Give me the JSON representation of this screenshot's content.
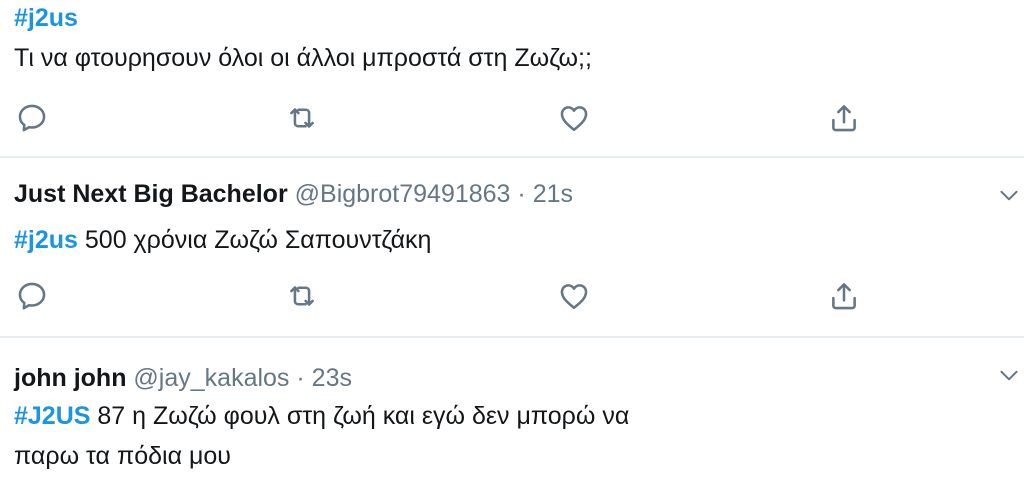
{
  "tweets": [
    {
      "hashtag": "#j2us",
      "text": "Τι να φτουρησουν όλοι οι άλλοι μπροστά στη Ζωζω;;"
    },
    {
      "name": "Just Next Big Bachelor",
      "handle": "@Bigbrot79491863",
      "separator": "·",
      "time": "21s",
      "hashtag": "#j2us",
      "text": " 500 χρόνια Ζωζώ Σαπουντζάκη"
    },
    {
      "name": "john john",
      "handle": "@jay_kakalos",
      "separator": "·",
      "time": "23s",
      "hashtag": "#J2US",
      "text": " 87 η Ζωζώ φουλ στη ζωή και εγώ δεν μπορώ να",
      "text_line2": "παρω τα πόδια μου"
    }
  ],
  "icons": {
    "reply": "reply-icon",
    "retweet": "retweet-icon",
    "like": "heart-icon",
    "share": "share-icon",
    "caret": "chevron-down-icon"
  },
  "colors": {
    "hashtag": "#1b95e0",
    "secondary_text": "#657786",
    "divider": "#e6ecf0",
    "icon": "#657786"
  }
}
